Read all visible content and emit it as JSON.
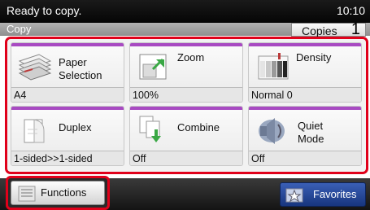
{
  "status": {
    "message": "Ready to copy.",
    "time": "10:10"
  },
  "header": {
    "title": "Copy",
    "copies_label": "Copies",
    "copies_value": "1"
  },
  "functions": [
    {
      "label": "Paper Selection",
      "value": "A4",
      "icon": "paper-stack-icon"
    },
    {
      "label": "Zoom",
      "value": "100%",
      "icon": "zoom-icon"
    },
    {
      "label": "Density",
      "value": "Normal 0",
      "icon": "density-icon"
    },
    {
      "label": "Duplex",
      "value": "1-sided>>1-sided",
      "icon": "duplex-icon"
    },
    {
      "label": "Combine",
      "value": "Off",
      "icon": "combine-icon"
    },
    {
      "label": "Quiet Mode",
      "value": "Off",
      "icon": "quiet-mode-icon"
    }
  ],
  "bottom": {
    "functions_label": "Functions",
    "favorites_label": "Favorites"
  },
  "colors": {
    "accent_strip": "#a84ac2",
    "highlight_frame": "#e0001a",
    "favorites_blue": "#2a4aa0"
  }
}
